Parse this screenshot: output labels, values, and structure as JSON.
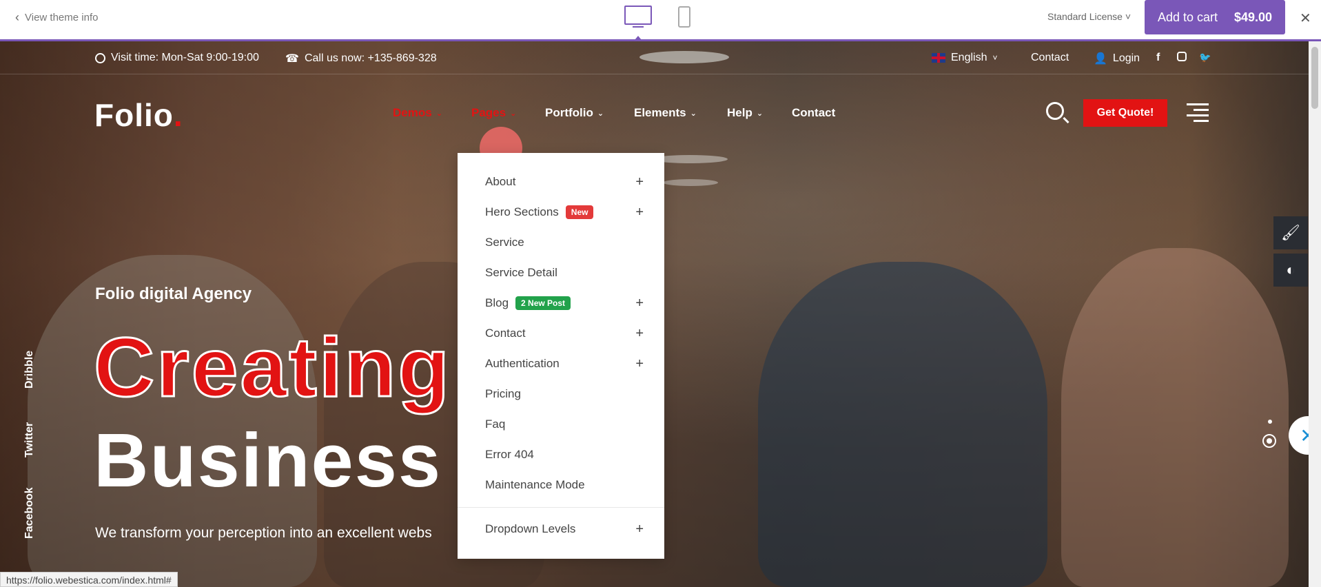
{
  "preview_bar": {
    "back_label": "View theme info",
    "license_label": "Standard License",
    "cart_label": "Add to cart",
    "price": "$49.00"
  },
  "topbar": {
    "visit_time": "Visit time: Mon-Sat 9:00-19:00",
    "call": "Call us now: +135-869-328",
    "language": "English",
    "contact": "Contact",
    "login": "Login"
  },
  "header": {
    "logo": "Folio",
    "logo_dot": ".",
    "nav": [
      {
        "label": "Demos",
        "active": true
      },
      {
        "label": "Pages",
        "active": true
      },
      {
        "label": "Portfolio",
        "active": false
      },
      {
        "label": "Elements",
        "active": false
      },
      {
        "label": "Help",
        "active": false
      },
      {
        "label": "Contact",
        "active": false
      }
    ],
    "quote_button": "Get Quote!"
  },
  "hero": {
    "tagline": "Folio digital Agency",
    "heading_line1": "Creating R",
    "heading_line2": "Business V",
    "subtitle": "We transform your perception into an excellent webs"
  },
  "social": [
    "Dribble",
    "Twitter",
    "Facebook"
  ],
  "dropdown": {
    "items": [
      {
        "label": "About",
        "has_children": true
      },
      {
        "label": "Hero Sections",
        "badge": "New",
        "has_children": true
      },
      {
        "label": "Service",
        "has_children": false
      },
      {
        "label": "Service Detail",
        "has_children": false
      },
      {
        "label": "Blog",
        "badge": "2 New Post",
        "has_children": true
      },
      {
        "label": "Contact",
        "has_children": true
      },
      {
        "label": "Authentication",
        "has_children": true
      },
      {
        "label": "Pricing",
        "has_children": false
      },
      {
        "label": "Faq",
        "has_children": false
      },
      {
        "label": "Error 404",
        "has_children": false
      },
      {
        "label": "Maintenance Mode",
        "has_children": false
      },
      {
        "label": "Dropdown Levels",
        "has_children": true
      }
    ],
    "plus_symbol": "+"
  },
  "status_url": "https://folio.webestica.com/index.html#",
  "colors": {
    "accent": "#7a57b8",
    "brand_red": "#e21313",
    "badge_new": "#e33a3a",
    "badge_blog": "#22a24b"
  }
}
